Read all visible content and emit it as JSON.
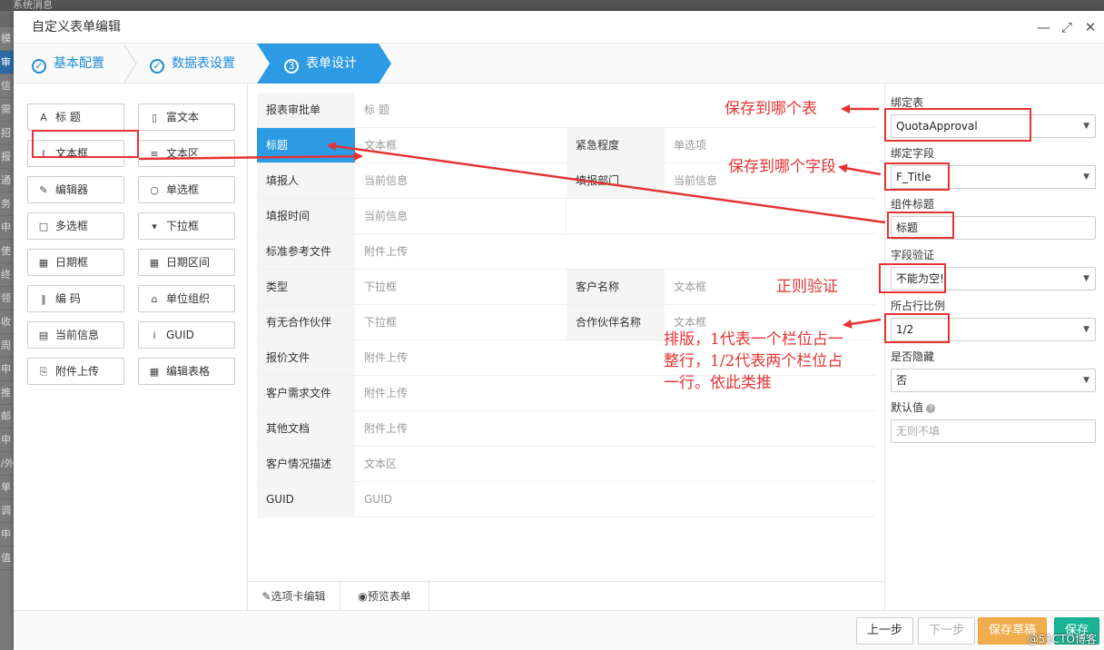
{
  "background": {
    "top_text": "系统消息",
    "side_items": [
      "模",
      "审",
      "信",
      "需",
      "招",
      "报",
      "通",
      "务",
      "申",
      "使",
      "终",
      "领",
      "收",
      "周",
      "申",
      "推",
      "邮",
      "申",
      "/外",
      "单",
      "调",
      "申",
      "值"
    ]
  },
  "dialog": {
    "title": "自定义表单编辑",
    "ctrl_min": "—",
    "ctrl_max": "⤢",
    "ctrl_close": "✕"
  },
  "steps": [
    {
      "label": "基本配置",
      "marker": "✓"
    },
    {
      "label": "数据表设置",
      "marker": "✓"
    },
    {
      "label": "表单设计",
      "marker": "3"
    }
  ],
  "palette": [
    {
      "label": "标 题",
      "icon": "A"
    },
    {
      "label": "富文本",
      "icon": "▯"
    },
    {
      "label": "文本框",
      "icon": "I"
    },
    {
      "label": "文本区",
      "icon": "≡"
    },
    {
      "label": "编辑器",
      "icon": "✎"
    },
    {
      "label": "单选框",
      "icon": "○"
    },
    {
      "label": "多选框",
      "icon": "□"
    },
    {
      "label": "下拉框",
      "icon": "▾"
    },
    {
      "label": "日期框",
      "icon": "▦"
    },
    {
      "label": "日期区间",
      "icon": "▦"
    },
    {
      "label": "编 码",
      "icon": "‖"
    },
    {
      "label": "单位组织",
      "icon": "⌂"
    },
    {
      "label": "当前信息",
      "icon": "▤"
    },
    {
      "label": "GUID",
      "icon": "i"
    },
    {
      "label": "附件上传",
      "icon": "⎘"
    },
    {
      "label": "编辑表格",
      "icon": "▦"
    }
  ],
  "form": {
    "title_label": "报表审批单",
    "title_value": "标 题",
    "rows": [
      {
        "l1": "标题",
        "v1": "文本框",
        "l2": "紧急程度",
        "v2": "单选项"
      },
      {
        "l1": "填报人",
        "v1": "当前信息",
        "l2": "填报部门",
        "v2": "当前信息"
      },
      {
        "l1": "填报时间",
        "v1": "当前信息"
      },
      {
        "l1": "标准参考文件",
        "v1": "附件上传"
      },
      {
        "l1": "类型",
        "v1": "下拉框",
        "l2": "客户名称",
        "v2": "文本框"
      },
      {
        "l1": "有无合作伙伴",
        "v1": "下拉框",
        "l2": "合作伙伴名称",
        "v2": "文本框"
      },
      {
        "l1": "报价文件",
        "v1": "附件上传"
      },
      {
        "l1": "客户需求文件",
        "v1": "附件上传"
      },
      {
        "l1": "其他文档",
        "v1": "附件上传"
      },
      {
        "l1": "客户情况描述",
        "v1": "文本区"
      },
      {
        "l1": "GUID",
        "v1": "GUID"
      }
    ]
  },
  "canvas_tabs": [
    {
      "label": "选项卡编辑",
      "icon": "✎"
    },
    {
      "label": "预览表单",
      "icon": "◉"
    }
  ],
  "props": {
    "bind_table_label": "绑定表",
    "bind_table_value": "QuotaApproval",
    "bind_field_label": "绑定字段",
    "bind_field_value": "F_Title",
    "comp_title_label": "组件标题",
    "comp_title_value": "标题",
    "validate_label": "字段验证",
    "validate_value": "不能为空!",
    "ratio_label": "所占行比例",
    "ratio_value": "1/2",
    "hidden_label": "是否隐藏",
    "hidden_value": "否",
    "default_label": "默认值",
    "default_placeholder": "无则不填"
  },
  "footer": {
    "prev": "上一步",
    "next": "下一步",
    "save_draft": "保存草稿",
    "save": "保存"
  },
  "annotations": {
    "a1": "保存到哪个表",
    "a2": "保存到哪个字段",
    "a3": "正则验证",
    "a4_line1": "排版，1代表一个栏位占一",
    "a4_line2": "整行，1/2代表两个栏位占",
    "a4_line3": "一行。依此类推"
  },
  "watermark": "@51CTO博客",
  "colors": {
    "accent": "#2d9be3",
    "annotation": "#e53333",
    "warn": "#f0ad4e",
    "ok": "#1ab394"
  }
}
